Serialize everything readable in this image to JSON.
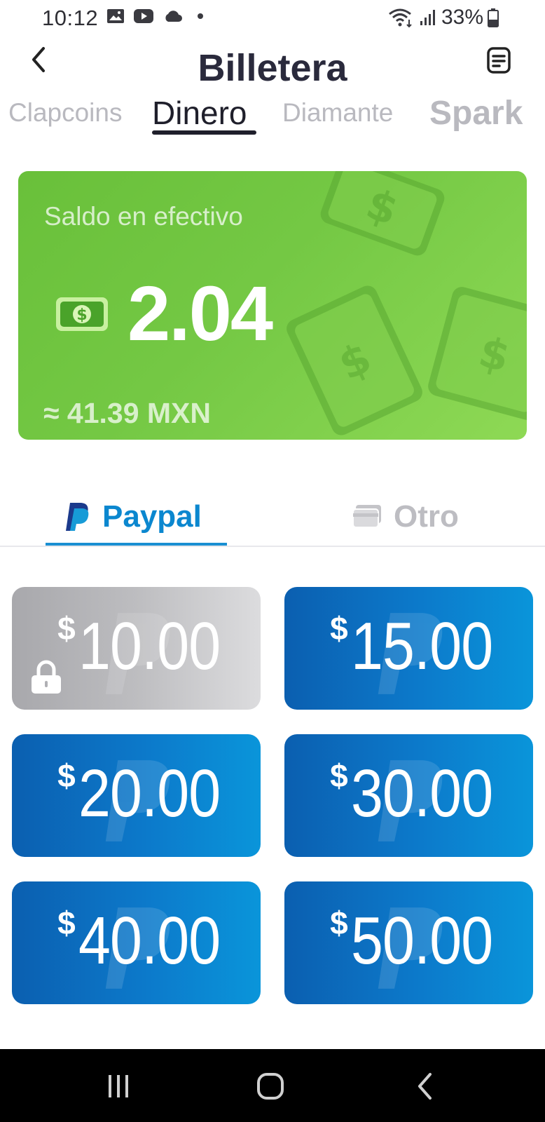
{
  "status_bar": {
    "time": "10:12",
    "battery": "33%"
  },
  "header": {
    "title": "Billetera"
  },
  "tabs": [
    {
      "label": "Clapcoins",
      "active": false
    },
    {
      "label": "Dinero",
      "active": true
    },
    {
      "label": "Diamante",
      "active": false
    },
    {
      "label": "Spark",
      "active": false
    }
  ],
  "balance": {
    "label": "Saldo en efectivo",
    "amount": "2.04",
    "converted": "≈ 41.39 MXN"
  },
  "payment_methods": [
    {
      "label": "Paypal",
      "active": true,
      "icon": "paypal-icon"
    },
    {
      "label": "Otro",
      "active": false,
      "icon": "card-icon"
    }
  ],
  "amounts": [
    {
      "currency": "$",
      "value": "10.00",
      "locked": true
    },
    {
      "currency": "$",
      "value": "15.00",
      "locked": false
    },
    {
      "currency": "$",
      "value": "20.00",
      "locked": false
    },
    {
      "currency": "$",
      "value": "30.00",
      "locked": false
    },
    {
      "currency": "$",
      "value": "40.00",
      "locked": false
    },
    {
      "currency": "$",
      "value": "50.00",
      "locked": false
    }
  ],
  "colors": {
    "card_green": "#74c844",
    "paypal_blue": "#0b87cf",
    "button_blue": "#0c7acb",
    "locked_gray": "#bdbdc0"
  }
}
